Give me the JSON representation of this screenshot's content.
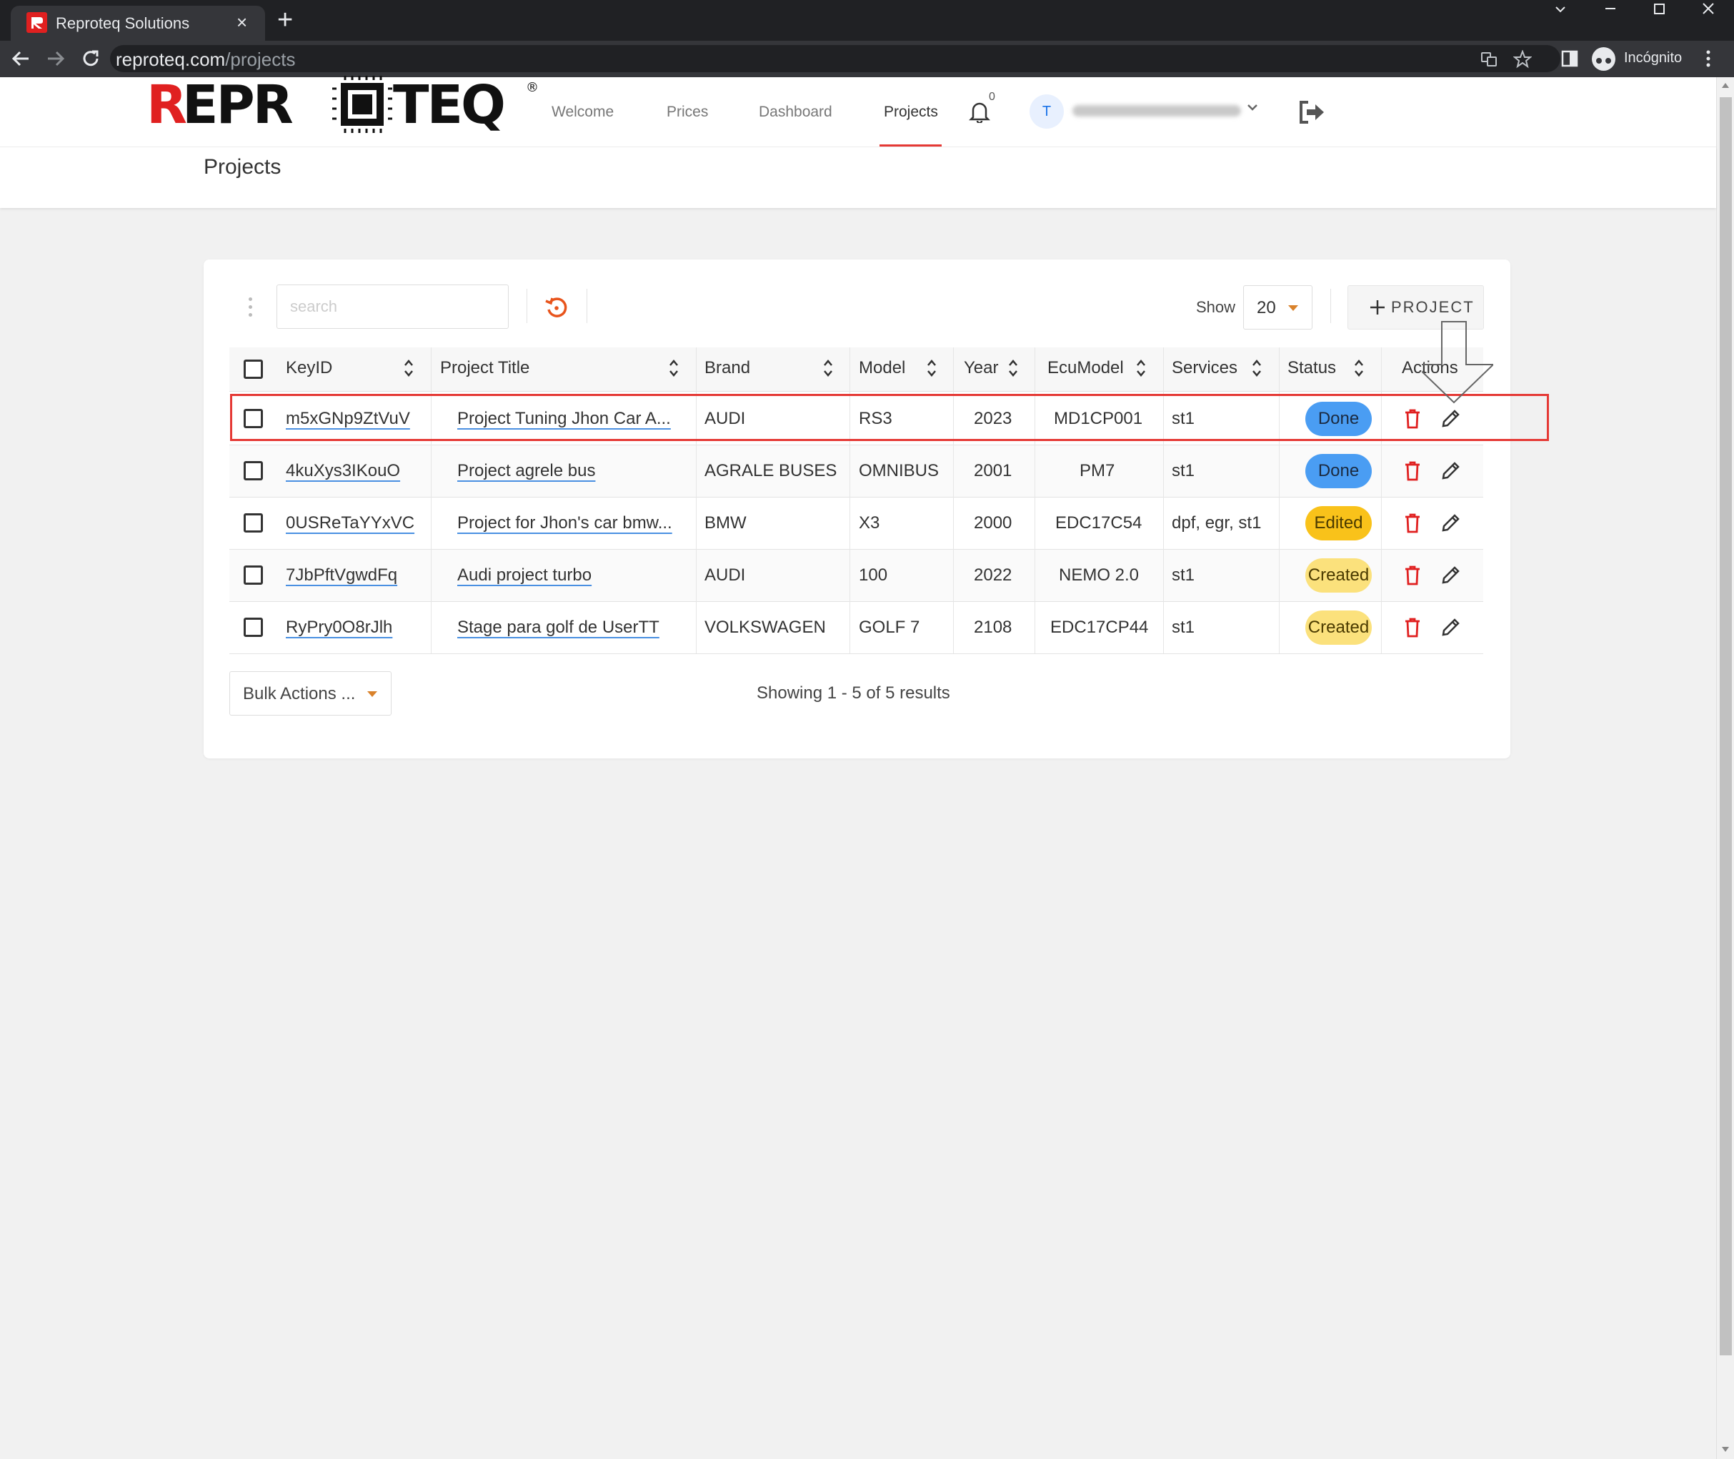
{
  "browser": {
    "tab_title": "Reproteq Solutions",
    "tab_close": "×",
    "new_tab": "+",
    "url_host": "reproteq.com",
    "url_path": "/projects",
    "incognito_label": "Incógnito"
  },
  "site": {
    "logo_text": "REPROTEQ",
    "brand_color": "#e02020"
  },
  "nav": {
    "welcome": "Welcome",
    "prices": "Prices",
    "dashboard": "Dashboard",
    "projects": "Projects",
    "notification_count": "0",
    "user_initial": "T"
  },
  "page": {
    "title": "Projects"
  },
  "toolbar": {
    "search_placeholder": "search",
    "show_label": "Show",
    "page_size": "20",
    "add_project_label": "PROJECT"
  },
  "table": {
    "headers": {
      "keyid": "KeyID",
      "project_title": "Project Title",
      "brand": "Brand",
      "model": "Model",
      "year": "Year",
      "ecumodel": "EcuModel",
      "services": "Services",
      "status": "Status",
      "actions": "Actions"
    },
    "rows": [
      {
        "keyid": "m5xGNp9ZtVuV",
        "title": "Project Tuning Jhon Car A...",
        "brand": "AUDI",
        "model": "RS3",
        "year": "2023",
        "ecumodel": "MD1CP001",
        "services": "st1",
        "status": "Done"
      },
      {
        "keyid": "4kuXys3IKouO",
        "title": "Project agrele bus",
        "brand": "AGRALE BUSES",
        "model": "OMNIBUS",
        "year": "2001",
        "ecumodel": "PM7",
        "services": "st1",
        "status": "Done"
      },
      {
        "keyid": "0USReTaYYxVC",
        "title": "Project for Jhon's car bmw...",
        "brand": "BMW",
        "model": "X3",
        "year": "2000",
        "ecumodel": "EDC17C54",
        "services": "dpf, egr, st1",
        "status": "Edited"
      },
      {
        "keyid": "7JbPftVgwdFq",
        "title": "Audi project turbo",
        "brand": "AUDI",
        "model": "100",
        "year": "2022",
        "ecumodel": "NEMO 2.0",
        "services": "st1",
        "status": "Created"
      },
      {
        "keyid": "RyPry0O8rJlh",
        "title": "Stage para golf de UserTT",
        "brand": "VOLKSWAGEN",
        "model": "GOLF 7",
        "year": "2108",
        "ecumodel": "EDC17CP44",
        "services": "st1",
        "status": "Created"
      }
    ]
  },
  "footer": {
    "bulk_actions_label": "Bulk Actions ...",
    "results_text": "Showing 1 - 5 of 5 results"
  },
  "colors": {
    "done": "#4a9df3",
    "edited": "#f9c21a",
    "created": "#fbe17c",
    "accent": "#e53935",
    "orange": "#d9822b"
  }
}
